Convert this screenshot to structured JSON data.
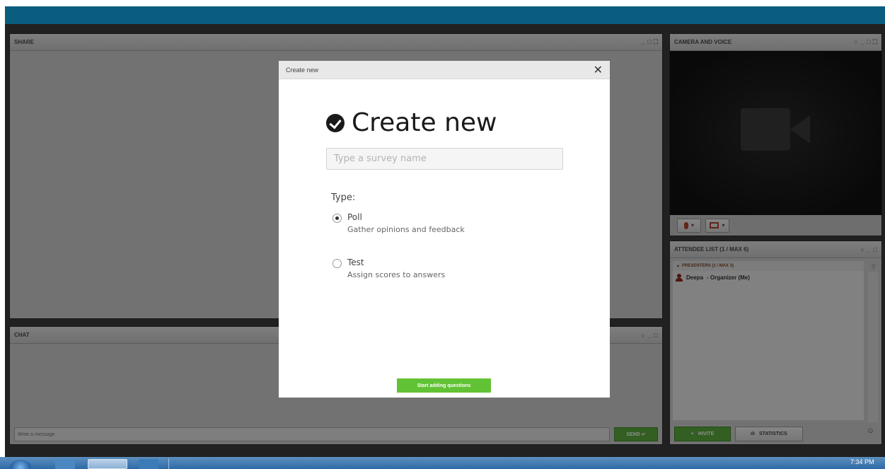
{
  "share_panel": {
    "title": "SHARE"
  },
  "chat_panel": {
    "title": "CHAT",
    "input_placeholder": "Write a message",
    "send_label": "SEND ↵"
  },
  "camera_panel": {
    "title": "CAMERA AND VOICE"
  },
  "attendee_panel": {
    "title": "ATTENDEE LIST (1 / MAX 6)",
    "presenters_header": "PRESENTERS (1 / MAX 3)",
    "entries": [
      {
        "name": "Deepa",
        "role": "- Organizer (Me)"
      }
    ],
    "invite_label": "INVITE",
    "statistics_label": "STATISTICS"
  },
  "modal": {
    "header_title": "Create new",
    "title": "Create new",
    "survey_placeholder": "Type a survey name",
    "type_label": "Type:",
    "options": [
      {
        "title": "Poll",
        "description": "Gather opinions and feedback",
        "selected": true
      },
      {
        "title": "Test",
        "description": "Assign scores to answers",
        "selected": false
      }
    ],
    "start_button_label": "Start adding questions"
  },
  "taskbar": {
    "clock": "7:34 PM"
  },
  "colors": {
    "top_bar": "#0b5d7f",
    "accent_green": "#62c235",
    "panel_bg": "#cfcfcf"
  },
  "icons": [
    "check-circle-icon",
    "close-icon",
    "camera-icon",
    "microphone-icon",
    "camera-off-icon",
    "person-icon",
    "search-icon",
    "invite-icon",
    "statistics-icon",
    "menu-icon",
    "send-icon",
    "start-orb-icon"
  ]
}
